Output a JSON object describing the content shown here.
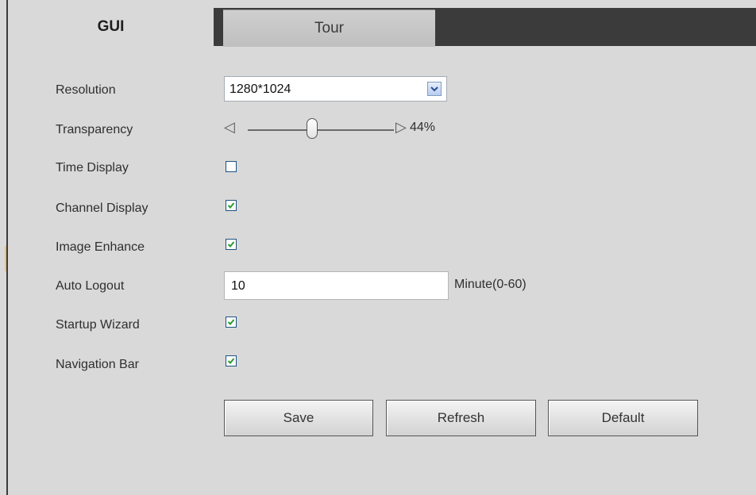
{
  "tabs": [
    {
      "label": "GUI",
      "active": true
    },
    {
      "label": "Tour",
      "active": false
    }
  ],
  "form": {
    "resolution": {
      "label": "Resolution",
      "value": "1280*1024"
    },
    "transparency": {
      "label": "Transparency",
      "value_text": "44%",
      "value": 0.44,
      "left_symbol": "◁",
      "right_symbol": "▷"
    },
    "time_display": {
      "label": "Time Display",
      "checked": false
    },
    "channel_display": {
      "label": "Channel Display",
      "checked": true
    },
    "image_enhance": {
      "label": "Image Enhance",
      "checked": true
    },
    "auto_logout": {
      "label": "Auto Logout",
      "value": "10",
      "unit": "Minute(0-60)"
    },
    "startup_wizard": {
      "label": "Startup Wizard",
      "checked": true
    },
    "navigation_bar": {
      "label": "Navigation Bar",
      "checked": true
    }
  },
  "buttons": {
    "save": "Save",
    "refresh": "Refresh",
    "default": "Default"
  },
  "colors": {
    "background": "#d9d9d9",
    "tabbar": "#3b3b3b",
    "checkmark": "#2e9a2e",
    "checkbox_border": "#1c5180"
  },
  "icons": {
    "dropdown": "chevron-down-icon",
    "checkmark": "checkmark-icon",
    "slider_left": "triangle-left-icon",
    "slider_right": "triangle-right-icon"
  }
}
